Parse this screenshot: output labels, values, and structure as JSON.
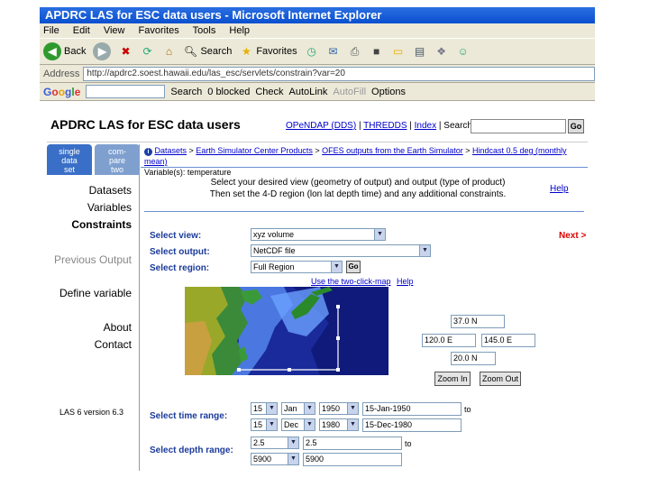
{
  "browser": {
    "window_title": "APDRC LAS for ESC data users - Microsoft Internet Explorer",
    "menu": [
      "File",
      "Edit",
      "View",
      "Favorites",
      "Tools",
      "Help"
    ],
    "toolbar": {
      "back": "Back",
      "search": "Search",
      "favorites": "Favorites"
    },
    "address_label": "Address",
    "address_value": "http://apdrc2.soest.hawaii.edu/las_esc/servlets/constrain?var=20",
    "google": {
      "logo": [
        "G",
        "o",
        "o",
        "g",
        "l",
        "e"
      ],
      "search": "Search",
      "blocked": "0 blocked",
      "check": "Check",
      "autolink": "AutoLink",
      "autofill": "AutoFill",
      "options": "Options"
    }
  },
  "page": {
    "title": "APDRC LAS for ESC data users",
    "header_links": [
      "OPeNDAP (DDS)",
      "THREDDS",
      "Index",
      "Search:"
    ],
    "search_go": "Go",
    "tabs": [
      {
        "label_lines": [
          "single",
          "data",
          "set"
        ]
      },
      {
        "label_lines": [
          "com-",
          "pare",
          "two"
        ]
      }
    ],
    "nav": {
      "datasets": "Datasets",
      "variables": "Variables",
      "constraints": "Constraints",
      "previous_output": "Previous Output",
      "define_variable": "Define variable",
      "about": "About",
      "contact": "Contact",
      "version": "LAS 6 version 6.3"
    },
    "breadcrumb": {
      "items": [
        "Datasets",
        "Earth Simulator Center Products",
        "OFES outputs from the Earth Simulator",
        "Hindcast 0.5 deg (monthly mean)"
      ],
      "variable_line": "Variable(s): temperature"
    },
    "instructions": {
      "line1": "Select your desired view (geometry of output) and output (type of product)",
      "line2": "Then set the 4-D region (lon lat depth time) and any additional constraints."
    },
    "help": "Help",
    "next": "Next >",
    "select_view": {
      "label": "Select view:",
      "value": "xyz volume"
    },
    "select_output": {
      "label": "Select output:",
      "value": "NetCDF file"
    },
    "select_region": {
      "label": "Select region:",
      "value": "Full Region",
      "go": "Go"
    },
    "map_links": {
      "two_click": "Use the two-click-map",
      "help": "Help"
    },
    "coords": {
      "north": "37.0 N",
      "west": "120.0 E",
      "east": "145.0 E",
      "south": "20.0 N"
    },
    "zoom_in": "Zoom In",
    "zoom_out": "Zoom Out",
    "time_range": {
      "label": "Select time range:",
      "start": {
        "day": "15",
        "month": "Jan",
        "year": "1950",
        "text": "15-Jan-1950"
      },
      "end": {
        "day": "15",
        "month": "Dec",
        "year": "1980",
        "text": "15-Dec-1980"
      },
      "to": "to"
    },
    "depth_range": {
      "label": "Select depth range:",
      "min_select": "2.5",
      "min_text": "2.5",
      "max_select": "5900",
      "max_text": "5900",
      "to": "to"
    }
  }
}
